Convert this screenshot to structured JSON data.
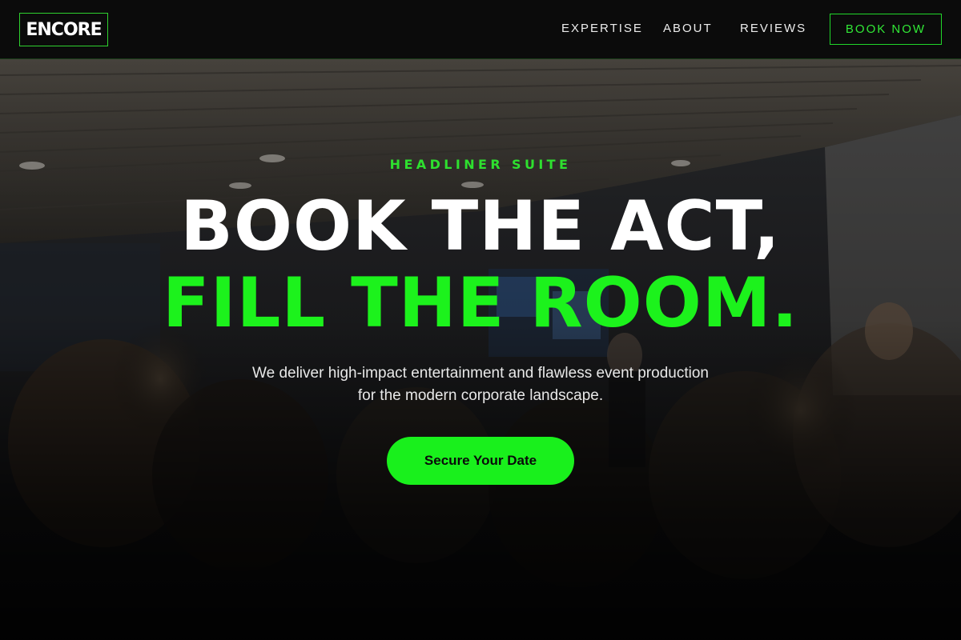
{
  "brand": {
    "logo_text": "ENCORE",
    "accent_color": "#1cf21c"
  },
  "nav": {
    "items": [
      {
        "label": "EXPERTISE"
      },
      {
        "label": "ABOUT"
      },
      {
        "label": "REVIEWS"
      }
    ],
    "book_label": "BOOK NOW"
  },
  "hero": {
    "eyebrow": "HEADLINER SUITE",
    "headline_line1": "BOOK THE ACT,",
    "headline_line2": "FILL THE ROOM.",
    "lede_line1": "We deliver high-impact entertainment and flawless event production",
    "lede_line2": "for the modern corporate landscape.",
    "cta_label": "Secure Your Date",
    "background_image": "conference-audience-photo"
  }
}
